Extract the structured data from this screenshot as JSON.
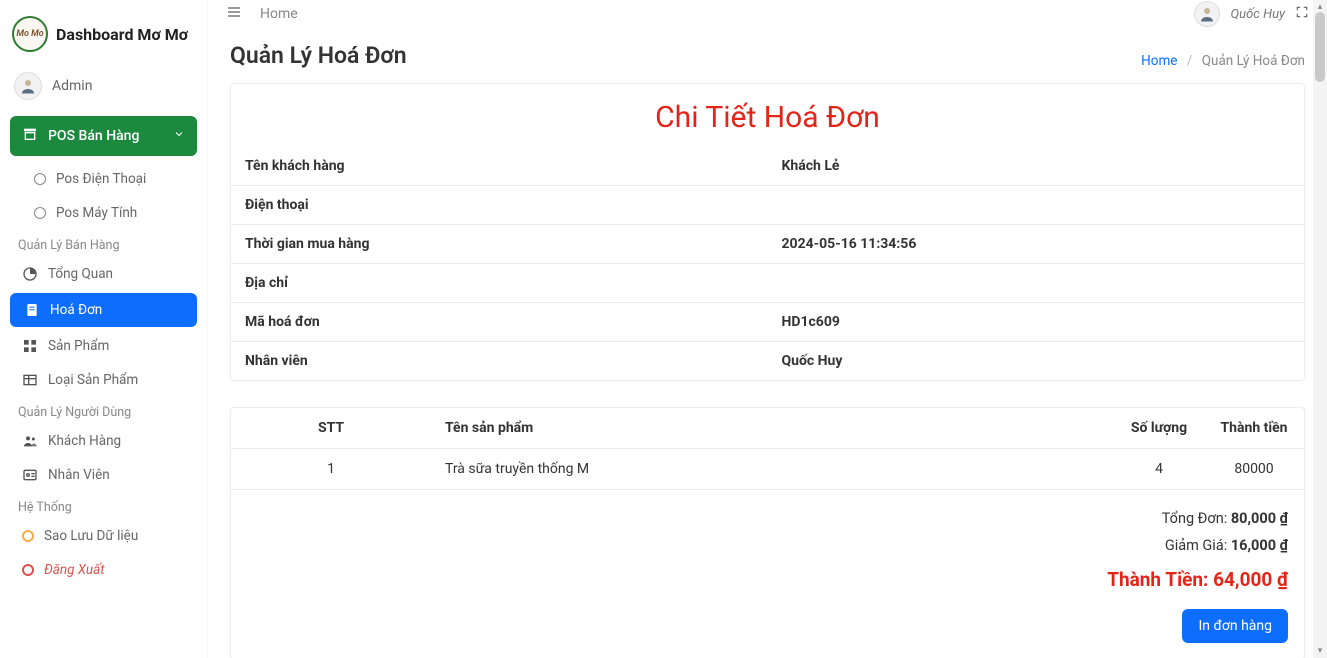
{
  "brand": {
    "title": "Dashboard Mơ Mơ",
    "logo_text": "Mo Mo"
  },
  "user": {
    "role": "Admin",
    "name": "Quốc Huy"
  },
  "topbar": {
    "breadcrumb": "Home",
    "home_link": "Home",
    "current": "Quản Lý Hoá Đơn"
  },
  "sidebar": {
    "pos_group": "POS Bán Hàng",
    "pos_phone": "Pos Điện Thoại",
    "pos_pc": "Pos Máy Tính",
    "section_sales": "Quản Lý Bán Hàng",
    "overview": "Tổng Quan",
    "invoice": "Hoá Đơn",
    "product": "Sản Phẩm",
    "category": "Loại Sản Phẩm",
    "section_users": "Quản Lý Người Dùng",
    "customer": "Khách Hàng",
    "staff": "Nhân Viên",
    "section_system": "Hệ Thống",
    "backup": "Sao Lưu Dữ liệu",
    "logout": "Đăng Xuất"
  },
  "page": {
    "title": "Quản Lý Hoá Đơn",
    "detail_title": "Chi Tiết Hoá Đơn"
  },
  "info": {
    "labels": {
      "customer": "Tên khách hàng",
      "phone": "Điện thoại",
      "time": "Thời gian mua hàng",
      "address": "Địa chỉ",
      "code": "Mã hoá đơn",
      "staff": "Nhân viên"
    },
    "values": {
      "customer": "Khách Lẻ",
      "phone": "",
      "time": "2024-05-16 11:34:56",
      "address": "",
      "code": "HD1c609",
      "staff": "Quốc Huy"
    }
  },
  "items": {
    "headers": {
      "stt": "STT",
      "name": "Tên sản phẩm",
      "qty": "Số lượng",
      "amount": "Thành tiền"
    },
    "rows": [
      {
        "stt": "1",
        "name": "Trà sữa truyền thống M",
        "qty": "4",
        "amount": "80000"
      }
    ]
  },
  "totals": {
    "subtotal_label": "Tổng Đơn:",
    "subtotal_value": "80,000 ₫",
    "discount_label": "Giảm Giá:",
    "discount_value": "16,000 ₫",
    "grand_label": "Thành Tiền:",
    "grand_value": "64,000 ₫"
  },
  "buttons": {
    "print": "In đơn hàng"
  }
}
